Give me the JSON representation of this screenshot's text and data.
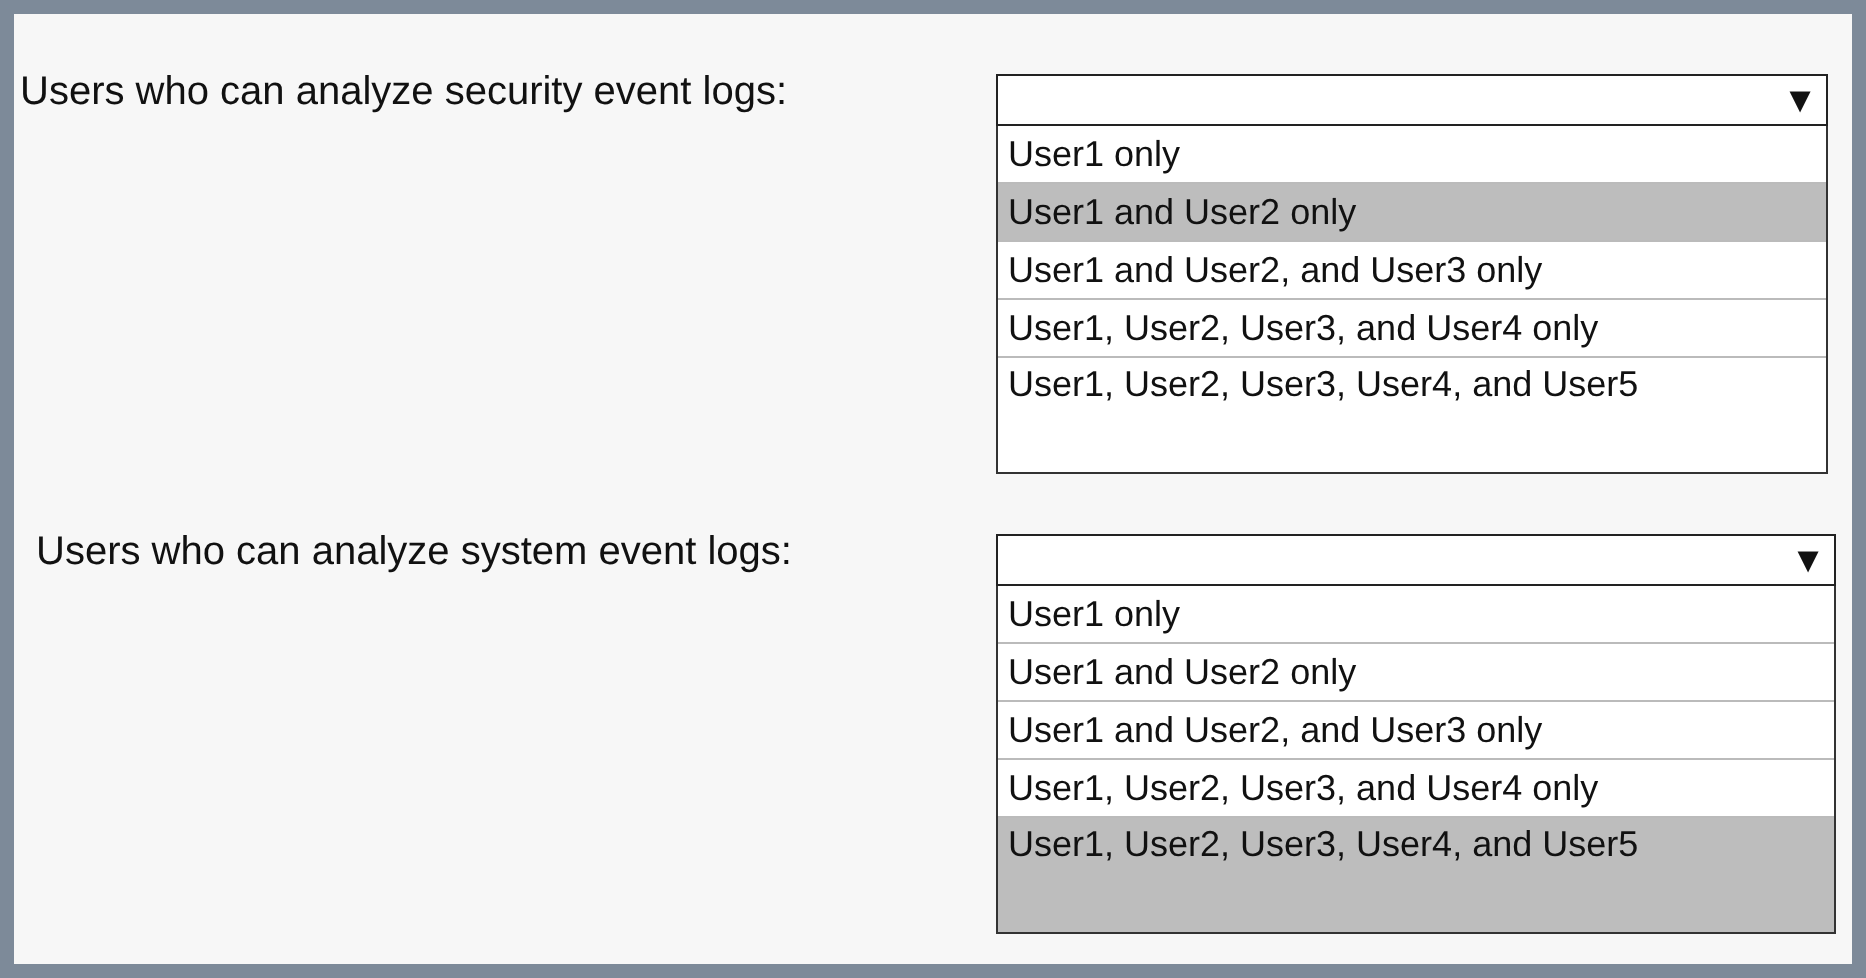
{
  "questions": [
    {
      "label": "Users who can analyze security event logs:",
      "arrow": "▼",
      "options": [
        {
          "text": "User1 only",
          "selected": false
        },
        {
          "text": "User1 and User2 only",
          "selected": true
        },
        {
          "text": "User1 and User2, and User3 only",
          "selected": false
        },
        {
          "text": "User1, User2, User3, and User4 only",
          "selected": false
        },
        {
          "text": "User1, User2, User3, User4, and User5",
          "selected": false
        }
      ]
    },
    {
      "label": "Users who can analyze system event logs:",
      "arrow": "▼",
      "options": [
        {
          "text": "User1 only",
          "selected": false
        },
        {
          "text": "User1 and User2 only",
          "selected": false
        },
        {
          "text": "User1 and User2, and User3 only",
          "selected": false
        },
        {
          "text": "User1, User2, User3, and User4 only",
          "selected": false
        },
        {
          "text": "User1, User2, User3, User4, and User5",
          "selected": true
        }
      ]
    }
  ]
}
